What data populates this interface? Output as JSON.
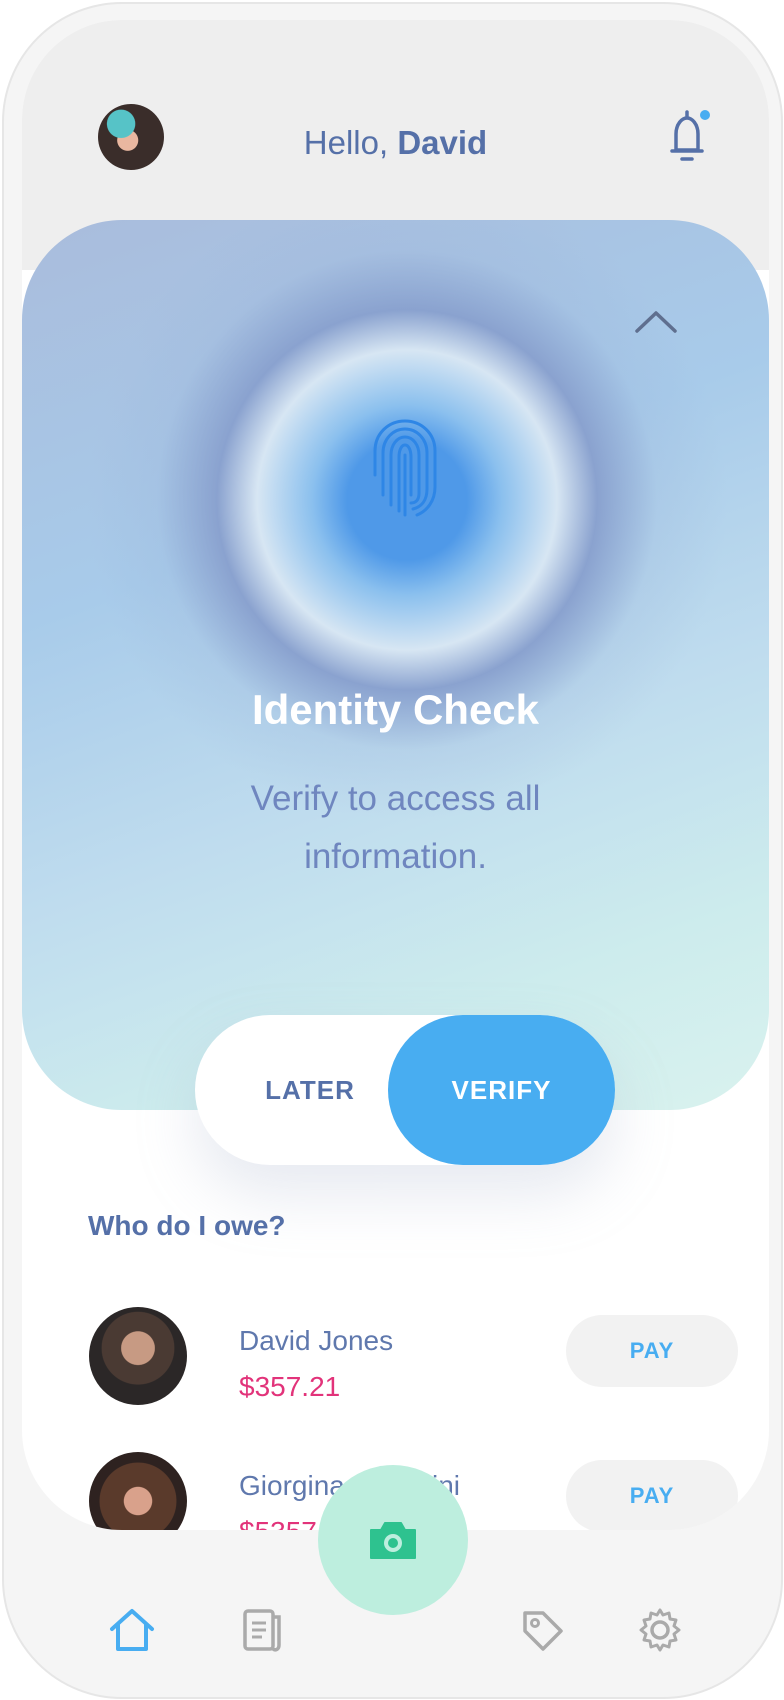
{
  "header": {
    "greeting_prefix": "Hello, ",
    "greeting_name": "David"
  },
  "identity_card": {
    "title": "Identity Check",
    "subtitle": "Verify to access all information.",
    "later_label": "LATER",
    "verify_label": "VERIFY"
  },
  "owe": {
    "section_title": "Who do I owe?",
    "items": [
      {
        "name": "David Jones",
        "amount": "$357.21",
        "action": "PAY"
      },
      {
        "name": "Giorgina Pulvarini",
        "amount": "$5357.21",
        "action": "PAY"
      }
    ]
  },
  "colors": {
    "accent": "#48adf1",
    "text": "#5570a8",
    "amount": "#e2337a",
    "camera": "#bdeede"
  },
  "nav": {
    "items": [
      "home-icon",
      "receipt-icon",
      "camera-icon",
      "tag-icon",
      "gear-icon"
    ]
  }
}
